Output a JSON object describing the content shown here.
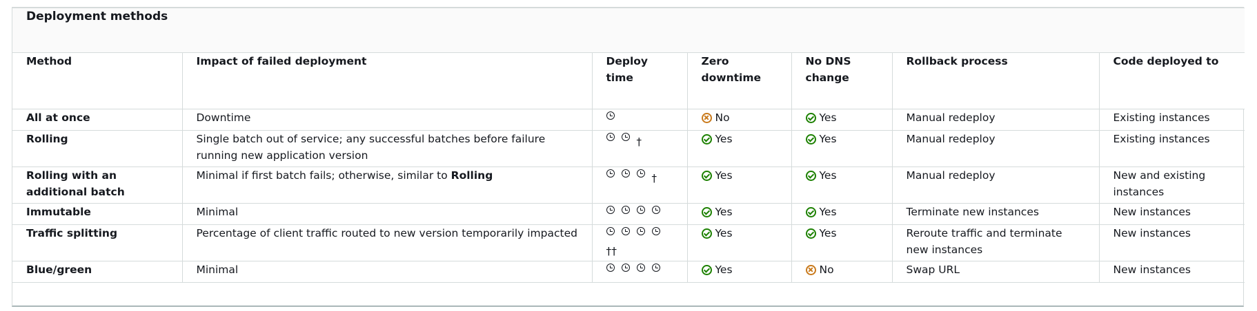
{
  "table": {
    "title": "Deployment methods",
    "headers": {
      "method": "Method",
      "impact": "Impact of failed deployment",
      "deploy_time": "Deploy time",
      "zero_downtime": "Zero downtime",
      "no_dns": "No DNS change",
      "rollback": "Rollback process",
      "code": "Code deployed to"
    },
    "rows": [
      {
        "method": "All at once",
        "impact": "Downtime",
        "clock_count": 1,
        "dagger": "",
        "zero_downtime": {
          "icon": "check-circle-icon",
          "status": "bad",
          "label": "No"
        },
        "no_dns": {
          "icon": "check-circle-icon",
          "status": "ok",
          "label": "Yes"
        },
        "rollback": "Manual redeploy",
        "code": "Existing instances"
      },
      {
        "method": "Rolling",
        "impact": "Single batch out of service; any successful batches before failure running new application version",
        "clock_count": 2,
        "dagger": "†",
        "zero_downtime": {
          "status": "ok",
          "label": "Yes"
        },
        "no_dns": {
          "status": "ok",
          "label": "Yes"
        },
        "rollback": "Manual redeploy",
        "code": "Existing instances"
      },
      {
        "method": "Rolling with an additional batch",
        "impact_prefix": "Minimal if first batch fails; otherwise, similar to ",
        "impact_bold": "Rolling",
        "clock_count": 3,
        "dagger": "†",
        "zero_downtime": {
          "status": "ok",
          "label": "Yes"
        },
        "no_dns": {
          "status": "ok",
          "label": "Yes"
        },
        "rollback": "Manual redeploy",
        "code": "New and existing instances"
      },
      {
        "method": "Immutable",
        "impact": "Minimal",
        "clock_count": 4,
        "dagger": "",
        "zero_downtime": {
          "status": "ok",
          "label": "Yes"
        },
        "no_dns": {
          "status": "ok",
          "label": "Yes"
        },
        "rollback": "Terminate new instances",
        "code": "New instances"
      },
      {
        "method": "Traffic splitting",
        "impact": "Percentage of client traffic routed to new version temporarily impacted",
        "clock_count": 4,
        "dagger": "††",
        "zero_downtime": {
          "status": "ok",
          "label": "Yes"
        },
        "no_dns": {
          "status": "ok",
          "label": "Yes"
        },
        "rollback": "Reroute traffic and terminate new instances",
        "code": "New instances"
      },
      {
        "method": "Blue/green",
        "impact": "Minimal",
        "clock_count": 4,
        "dagger": "",
        "zero_downtime": {
          "status": "ok",
          "label": "Yes"
        },
        "no_dns": {
          "status": "bad",
          "label": "No"
        },
        "rollback": "Swap URL",
        "code": "New instances"
      }
    ]
  }
}
